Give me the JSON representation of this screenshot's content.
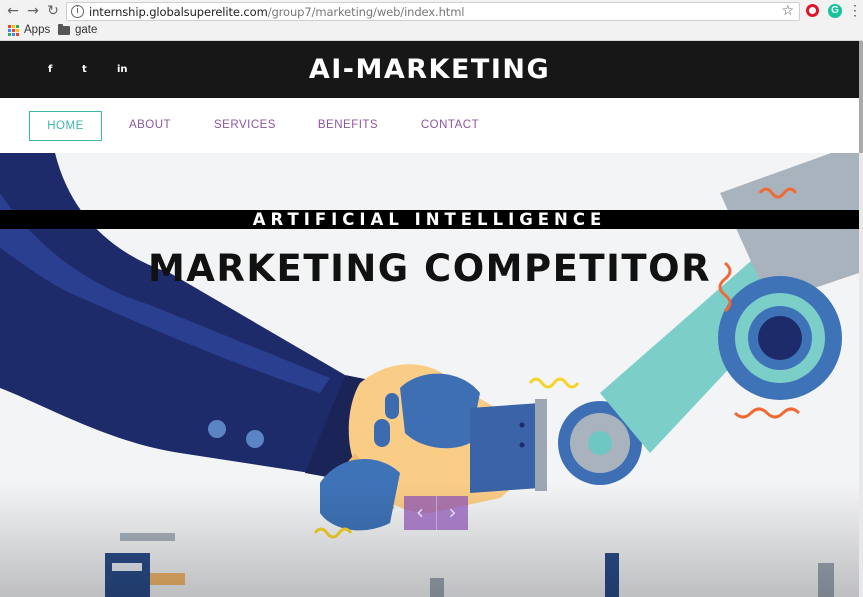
{
  "browser": {
    "url_host": "internship.globalsuperelite.com",
    "url_path": "/group7/marketing/web/index.html",
    "bookmarks": [
      {
        "label": "Apps",
        "icon": "apps-grid-icon"
      },
      {
        "label": "gate",
        "icon": "folder-icon"
      }
    ],
    "nav_icons": [
      "back-arrow-icon",
      "forward-arrow-icon",
      "reload-icon"
    ],
    "extensions": [
      "opera-icon",
      "grammarly-icon"
    ],
    "glyphs": {
      "back": "←",
      "forward": "→",
      "reload": "↻",
      "info": "i",
      "star": "☆",
      "ext_g": "G",
      "menu": "⋮"
    }
  },
  "site": {
    "brand": "AI-MARKETING",
    "social": [
      {
        "label": "f",
        "icon": "facebook-icon"
      },
      {
        "label": "t",
        "icon": "twitter-icon"
      },
      {
        "label": "in",
        "icon": "linkedin-icon"
      }
    ],
    "nav": [
      {
        "label": "HOME",
        "active": true
      },
      {
        "label": "ABOUT"
      },
      {
        "label": "SERVICES"
      },
      {
        "label": "BENEFITS"
      },
      {
        "label": "CONTACT"
      }
    ],
    "hero": {
      "band": "ARTIFICIAL INTELLIGENCE",
      "headline": "MARKETING COMPETITOR",
      "prev": "‹",
      "next": "›"
    }
  },
  "colors": {
    "topbar": "#171717",
    "nav_text": "#8e56a0",
    "active": "#3db7a8",
    "arrow_bg": "#8e56b4"
  }
}
